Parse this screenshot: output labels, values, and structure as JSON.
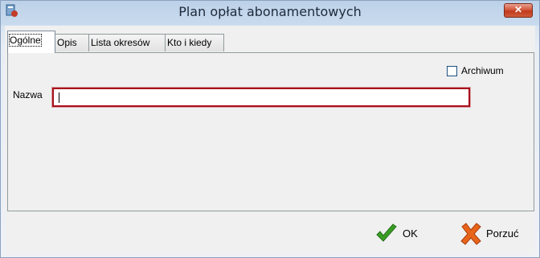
{
  "window": {
    "title": "Plan opłat abonamentowych",
    "close_glyph": "✕"
  },
  "tabs": [
    {
      "label": "Ogólne",
      "active": true
    },
    {
      "label": "Opis",
      "active": false
    },
    {
      "label": "Lista okresów",
      "active": false
    },
    {
      "label": "Kto i kiedy",
      "active": false
    }
  ],
  "form": {
    "archiwum_label": "Archiwum",
    "archiwum_checked": false,
    "nazwa_label": "Nazwa",
    "nazwa_value": ""
  },
  "footer": {
    "ok_label": "OK",
    "cancel_label": "Porzuć"
  },
  "icons": {
    "app": "app-icon",
    "ok": "checkmark-icon",
    "cancel": "cross-icon"
  },
  "colors": {
    "input_border": "#a8101c",
    "ok_green": "#3a9d23",
    "cancel_orange": "#e8641a"
  }
}
